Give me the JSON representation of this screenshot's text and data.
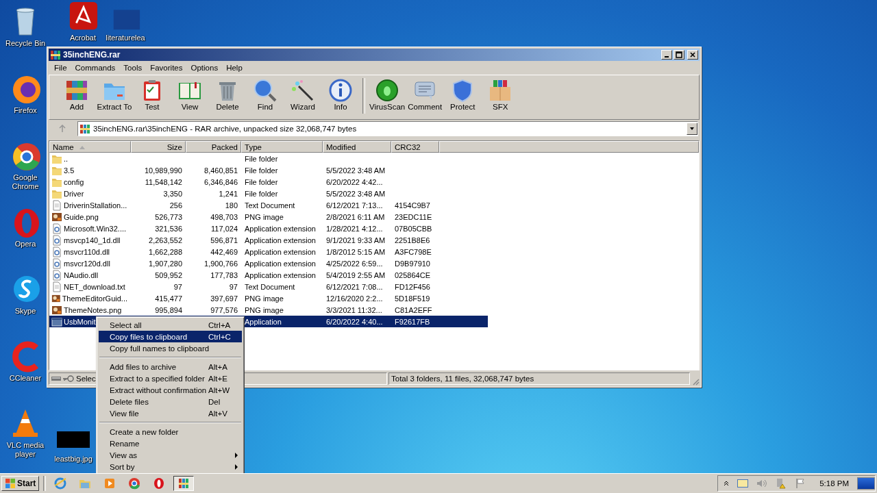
{
  "desktop_icons": [
    {
      "label": "Recycle Bin"
    },
    {
      "label": "Acrobat"
    },
    {
      "label": "literaturelea"
    },
    {
      "label": "Firefox"
    },
    {
      "label": "Google Chrome"
    },
    {
      "label": "Opera"
    },
    {
      "label": "Skype"
    },
    {
      "label": "CCleaner"
    },
    {
      "label": "VLC media player"
    },
    {
      "label": "leastbig.jpg"
    }
  ],
  "window": {
    "title": "35inchENG.rar",
    "menu": [
      "File",
      "Commands",
      "Tools",
      "Favorites",
      "Options",
      "Help"
    ],
    "toolbar": {
      "groups": [
        [
          "Add",
          "Extract To",
          "Test",
          "View",
          "Delete",
          "Find",
          "Wizard",
          "Info"
        ],
        [
          "VirusScan",
          "Comment",
          "Protect",
          "SFX"
        ]
      ]
    },
    "address": "35inchENG.rar\\35inchENG - RAR archive, unpacked size 32,068,747 bytes",
    "table": {
      "columns": [
        {
          "label": "Name",
          "sorted": true
        },
        {
          "label": "Size",
          "sorted": false
        },
        {
          "label": "Packed",
          "sorted": false
        },
        {
          "label": "Type",
          "sorted": false
        },
        {
          "label": "Modified",
          "sorted": false
        },
        {
          "label": "CRC32",
          "sorted": false
        }
      ],
      "rows": [
        {
          "kind": "folder",
          "name": "..",
          "type": "File folder",
          "selected": false
        },
        {
          "kind": "folder",
          "name": "3.5",
          "size": "10,989,990",
          "packed": "8,460,851",
          "type": "File folder",
          "modified": "5/5/2022 3:48 AM",
          "selected": false
        },
        {
          "kind": "folder",
          "name": "config",
          "size": "11,548,142",
          "packed": "6,346,846",
          "type": "File folder",
          "modified": "6/20/2022 4:42...",
          "selected": false
        },
        {
          "kind": "folder",
          "name": "Driver",
          "size": "3,350",
          "packed": "1,241",
          "type": "File folder",
          "modified": "5/5/2022 3:48 AM",
          "selected": false
        },
        {
          "kind": "text",
          "name": "DriverinStallation...",
          "size": "256",
          "packed": "180",
          "type": "Text Document",
          "modified": "6/12/2021 7:13...",
          "crc": "4154C9B7",
          "selected": false
        },
        {
          "kind": "image",
          "name": "Guide.png",
          "size": "526,773",
          "packed": "498,703",
          "type": "PNG image",
          "modified": "2/8/2021 6:11 AM",
          "crc": "23EDC11E",
          "selected": false
        },
        {
          "kind": "extension",
          "name": "Microsoft.Win32....",
          "size": "321,536",
          "packed": "117,024",
          "type": "Application extension",
          "modified": "1/28/2021 4:12...",
          "crc": "07B05CBB",
          "selected": false
        },
        {
          "kind": "extension",
          "name": "msvcp140_1d.dll",
          "size": "2,263,552",
          "packed": "596,871",
          "type": "Application extension",
          "modified": "9/1/2021 9:33 AM",
          "crc": "2251B8E6",
          "selected": false
        },
        {
          "kind": "extension",
          "name": "msvcr110d.dll",
          "size": "1,662,288",
          "packed": "442,469",
          "type": "Application extension",
          "modified": "1/8/2012 5:15 AM",
          "crc": "A3FC798E",
          "selected": false
        },
        {
          "kind": "extension",
          "name": "msvcr120d.dll",
          "size": "1,907,280",
          "packed": "1,900,766",
          "type": "Application extension",
          "modified": "4/25/2022 6:59...",
          "crc": "D9B97910",
          "selected": false
        },
        {
          "kind": "extension",
          "name": "NAudio.dll",
          "size": "509,952",
          "packed": "177,783",
          "type": "Application extension",
          "modified": "5/4/2019 2:55 AM",
          "crc": "025864CE",
          "selected": false
        },
        {
          "kind": "text",
          "name": "NET_download.txt",
          "size": "97",
          "packed": "97",
          "type": "Text Document",
          "modified": "6/12/2021 7:08...",
          "crc": "FD12F456",
          "selected": false
        },
        {
          "kind": "image",
          "name": "ThemeEditorGuid...",
          "size": "415,477",
          "packed": "397,697",
          "type": "PNG image",
          "modified": "12/16/2020 2:2...",
          "crc": "5D18F519",
          "selected": false
        },
        {
          "kind": "image",
          "name": "ThemeNotes.png",
          "size": "995,894",
          "packed": "977,576",
          "type": "PNG image",
          "modified": "3/3/2021 11:32...",
          "crc": "C81A2EFF",
          "selected": false
        },
        {
          "kind": "application",
          "name": "UsbMonit",
          "type": "Application",
          "modified": "6/20/2022 4:40...",
          "crc": "F92617FB",
          "selected": true
        }
      ]
    },
    "status_bar": {
      "left": "Selec",
      "right": "Total 3 folders, 11 files, 32,068,747 bytes"
    }
  },
  "context_menu": [
    {
      "kind": "item",
      "label": "Select all",
      "shortcut": "Ctrl+A",
      "selected": false,
      "submenu": false
    },
    {
      "kind": "item",
      "label": "Copy files to clipboard",
      "shortcut": "Ctrl+C",
      "selected": true,
      "submenu": false
    },
    {
      "kind": "item",
      "label": "Copy full names to clipboard",
      "selected": false,
      "submenu": false
    },
    {
      "kind": "separator"
    },
    {
      "kind": "item",
      "label": "Add files to archive",
      "shortcut": "Alt+A",
      "selected": false,
      "submenu": false
    },
    {
      "kind": "item",
      "label": "Extract to a specified folder",
      "shortcut": "Alt+E",
      "selected": false,
      "submenu": false
    },
    {
      "kind": "item",
      "label": "Extract without confirmation",
      "shortcut": "Alt+W",
      "selected": false,
      "submenu": false
    },
    {
      "kind": "item",
      "label": "Delete files",
      "shortcut": "Del",
      "selected": false,
      "submenu": false
    },
    {
      "kind": "item",
      "label": "View file",
      "shortcut": "Alt+V",
      "selected": false,
      "submenu": false
    },
    {
      "kind": "separator"
    },
    {
      "kind": "item",
      "label": "Create a new folder",
      "selected": false,
      "submenu": false
    },
    {
      "kind": "item",
      "label": "Rename",
      "selected": false,
      "submenu": false
    },
    {
      "kind": "item",
      "label": "View as",
      "selected": false,
      "submenu": true
    },
    {
      "kind": "item",
      "label": "Sort by",
      "selected": false,
      "submenu": true
    }
  ],
  "taskbar": {
    "start": "Start",
    "clock": "5:18 PM"
  }
}
